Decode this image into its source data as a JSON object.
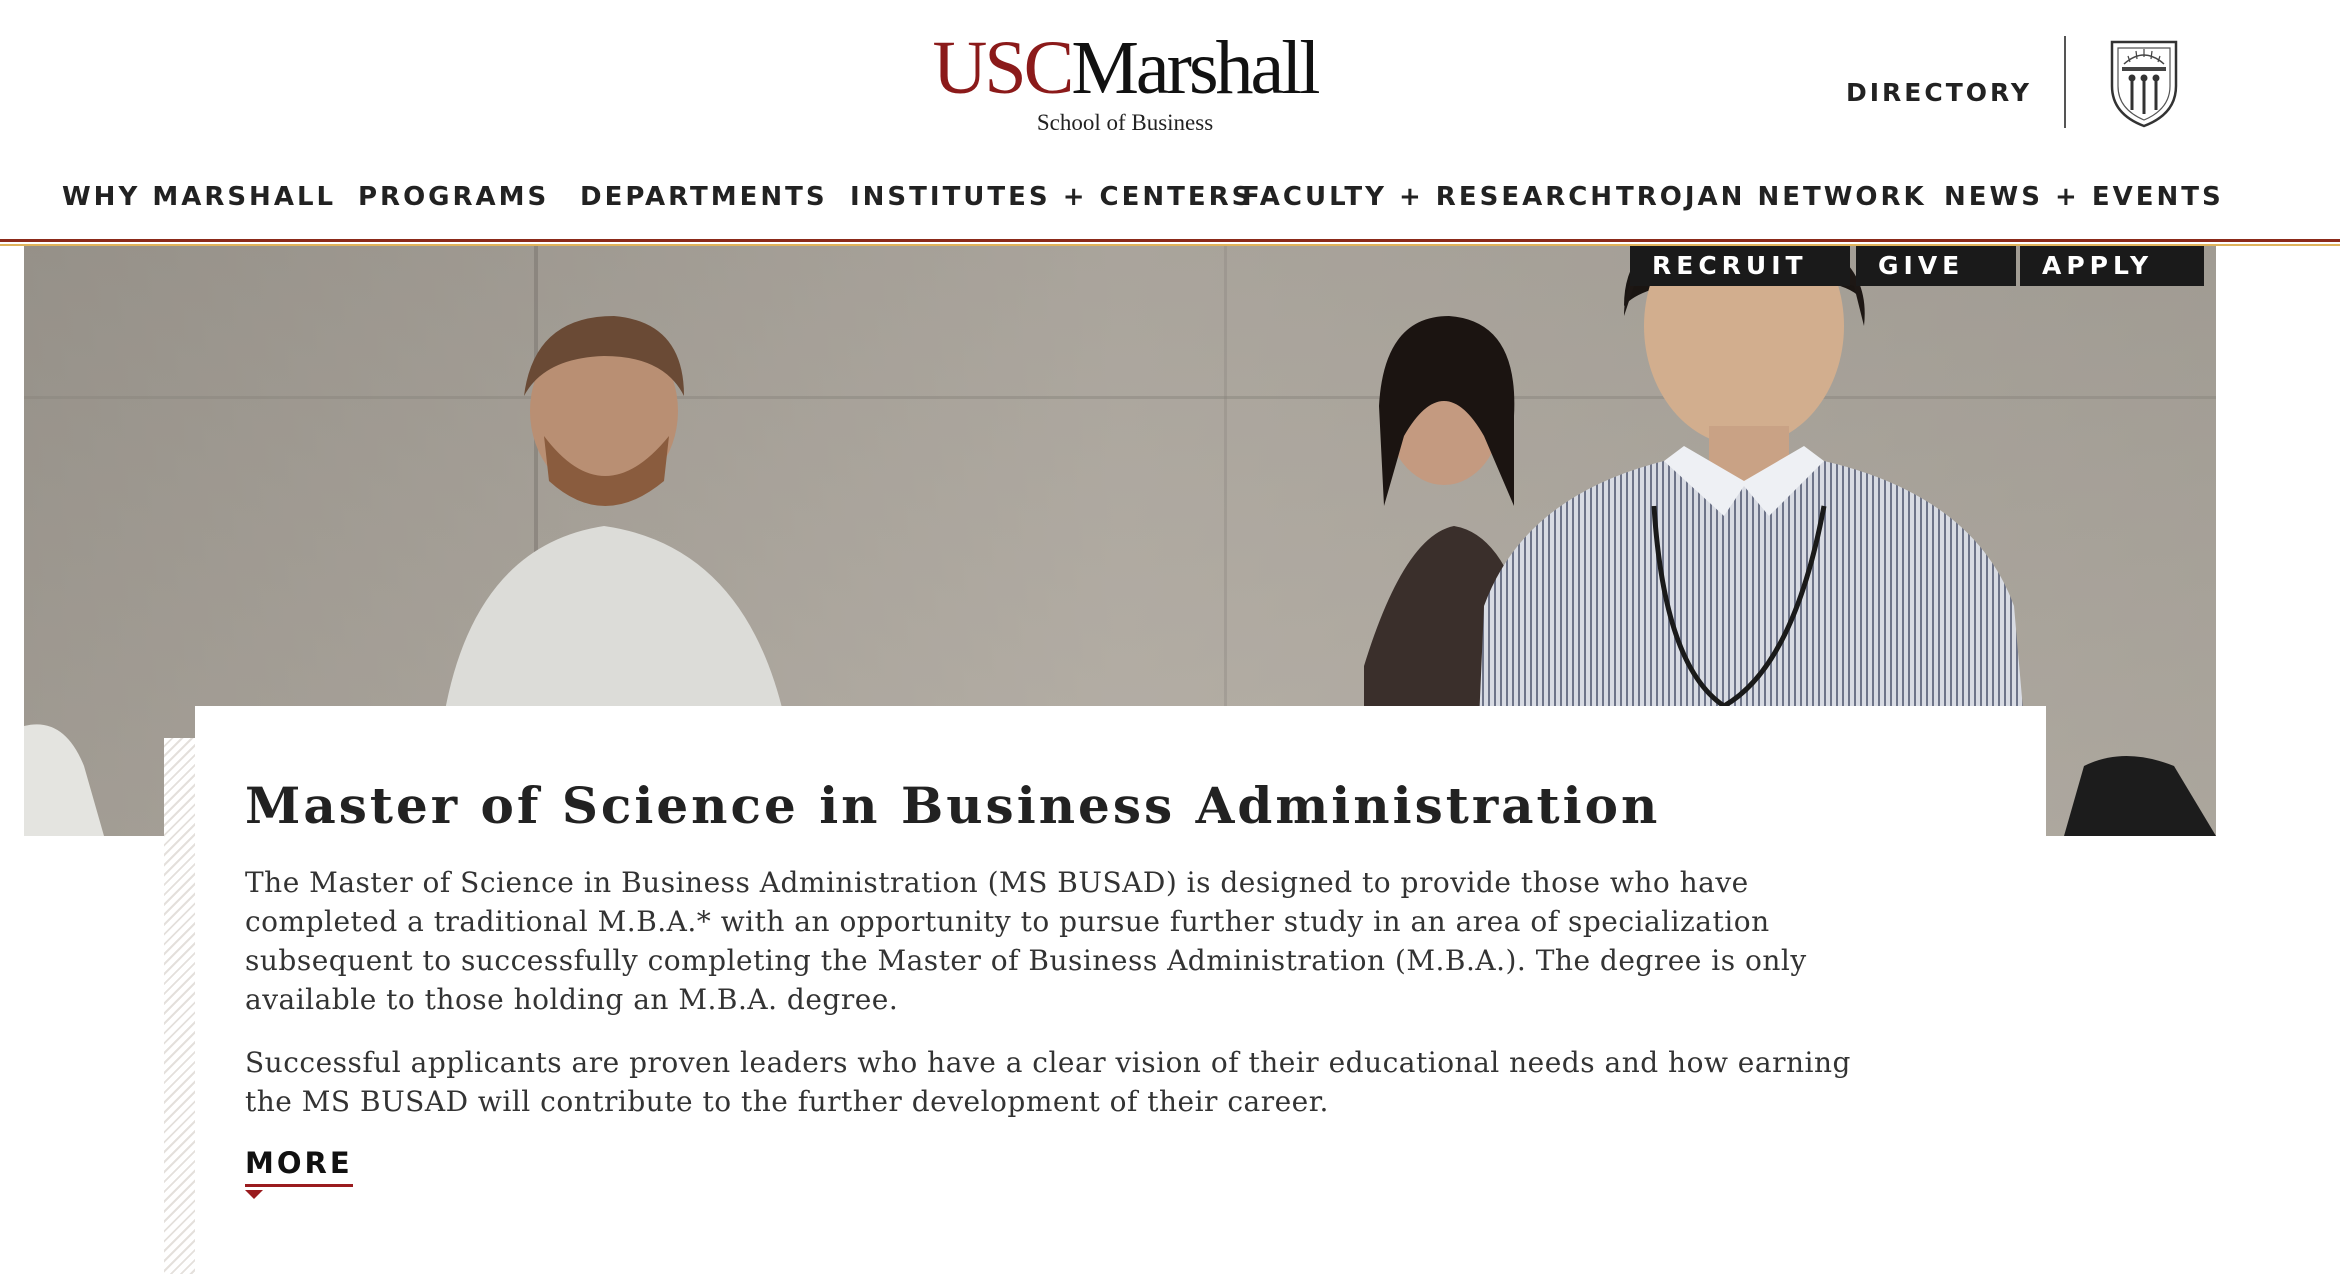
{
  "header": {
    "logo": {
      "usc": "USC",
      "marshall": "Marshall",
      "subtitle": "School of Business"
    },
    "directory_label": "DIRECTORY",
    "seal_icon": "usc-seal-icon"
  },
  "nav": {
    "items": [
      {
        "label": "WHY MARSHALL"
      },
      {
        "label": "PROGRAMS"
      },
      {
        "label": "DEPARTMENTS"
      },
      {
        "label": "INSTITUTES + CENTERS"
      },
      {
        "label": "FACULTY + RESEARCH"
      },
      {
        "label": "TROJAN NETWORK"
      },
      {
        "label": "NEWS + EVENTS"
      }
    ]
  },
  "cta": {
    "recruit": "RECRUIT",
    "give": "GIVE",
    "apply": "APPLY"
  },
  "content": {
    "title": "Master of Science in Business Administration",
    "paragraphs": [
      "The Master of Science in Business Administration (MS BUSAD) is designed to provide those who have completed a traditional M.B.A.* with an opportunity to pursue further study in an area of specialization subsequent to successfully completing the Master of Business Administration (M.B.A.). The degree is only available to those holding an M.B.A. degree.",
      "Successful applicants are proven leaders who have a clear vision of their educational needs and how earning the MS BUSAD will contribute to the further development of their career."
    ],
    "more_label": "MORE"
  },
  "colors": {
    "brand_cardinal": "#8b1a1a",
    "brand_gold": "#e0b35b",
    "cta_background": "#1a1a1a",
    "accent_underline": "#9a1b1e"
  }
}
